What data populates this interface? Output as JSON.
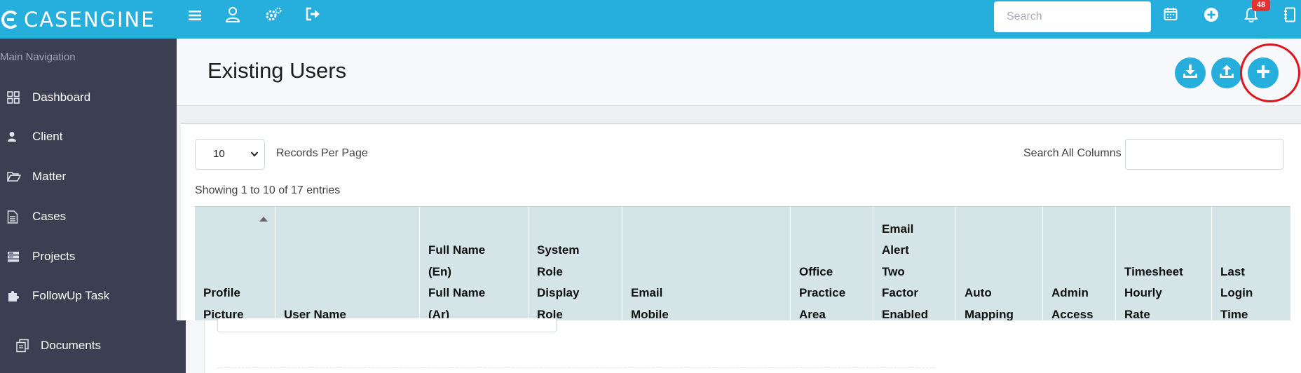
{
  "app": {
    "brand": "CASENGINE",
    "search_placeholder": "Search",
    "notification_count": "48",
    "accent": "#26aedd"
  },
  "topbar_icons": [
    "menu-icon",
    "user-icon",
    "settings-icon",
    "logout-icon",
    "calendar-icon",
    "add-circle-icon",
    "bell-icon",
    "notebook-icon"
  ],
  "sidebar": {
    "header": "Main Navigation",
    "items": [
      {
        "label": "Dashboard",
        "icon": "dashboard-grid-icon"
      },
      {
        "label": "Client",
        "icon": "person-icon"
      },
      {
        "label": "Matter",
        "icon": "folder-open-icon"
      },
      {
        "label": "Cases",
        "icon": "document-icon"
      },
      {
        "label": "Projects",
        "icon": "server-icon"
      },
      {
        "label": "FollowUp Task",
        "icon": "puzzle-icon"
      },
      {
        "label": "Documents",
        "icon": "copy-documents-icon"
      }
    ]
  },
  "page": {
    "title": "Existing Users",
    "actions": [
      {
        "name": "download",
        "icon": "download-icon"
      },
      {
        "name": "upload",
        "icon": "upload-icon"
      },
      {
        "name": "add-user",
        "icon": "plus-icon"
      }
    ]
  },
  "table_controls": {
    "per_page_value": "10",
    "per_page_label": "Records Per Page",
    "search_label": "Search All Columns",
    "showing_text": "Showing 1 to 10 of 17 entries"
  },
  "table": {
    "columns": [
      "Profile\nPicture",
      "User Name",
      "Full Name\n(En)\nFull Name\n(Ar)",
      "System\nRole\nDisplay\nRole",
      "Email\nMobile",
      "Office\nPractice\nArea",
      "Email\nAlert\nTwo\nFactor\nEnabled",
      "Auto\nMapping",
      "Admin\nAccess",
      "Timesheet\nHourly\nRate",
      "Last\nLogin\nTime"
    ]
  }
}
